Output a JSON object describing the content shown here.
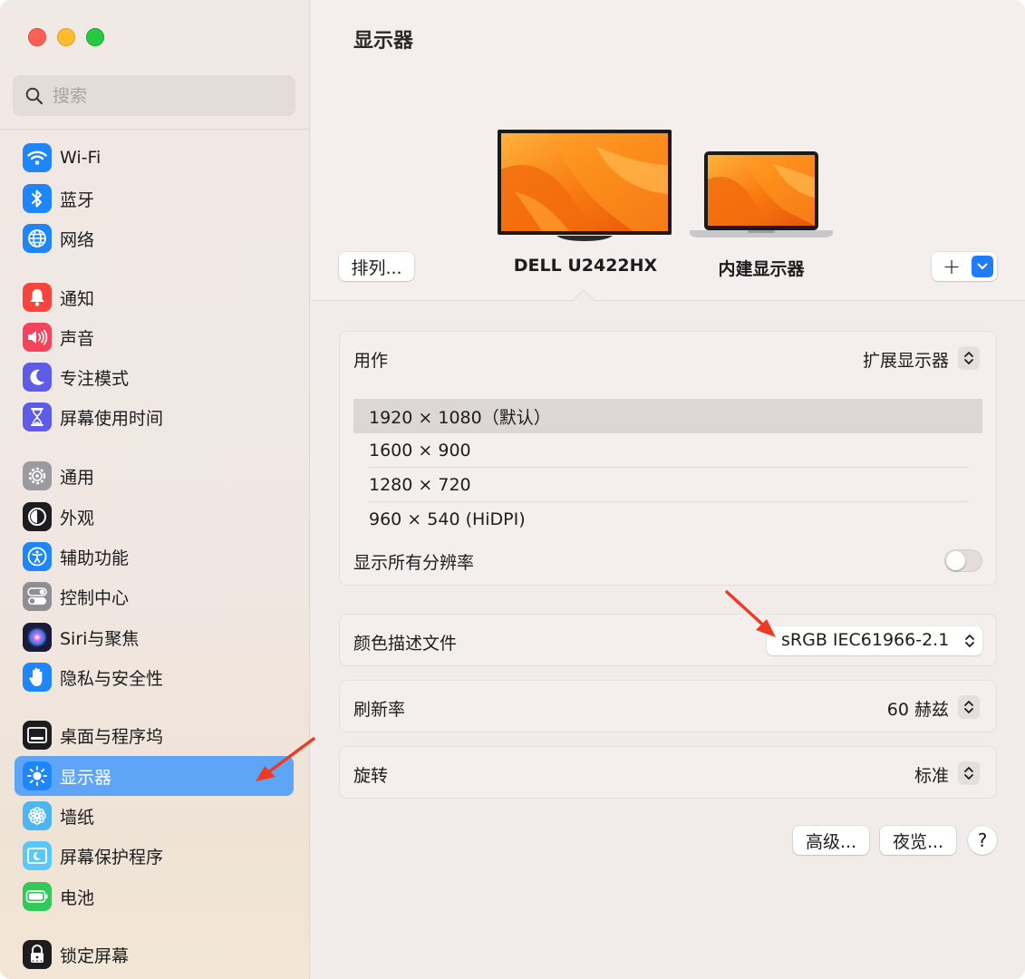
{
  "sidebar": {
    "search_placeholder": "搜索",
    "items": [
      {
        "label": "Wi-Fi",
        "icon": "wifi-icon",
        "color": "#1f86f8"
      },
      {
        "label": "蓝牙",
        "icon": "bluetooth-icon",
        "color": "#1f86f8"
      },
      {
        "label": "网络",
        "icon": "globe-icon",
        "color": "#1f86f8"
      },
      {
        "label": "通知",
        "icon": "bell-icon",
        "color": "#f7453b"
      },
      {
        "label": "声音",
        "icon": "speaker-icon",
        "color": "#f5435e"
      },
      {
        "label": "专注模式",
        "icon": "moon-icon",
        "color": "#5e5ce6"
      },
      {
        "label": "屏幕使用时间",
        "icon": "hourglass-icon",
        "color": "#5e5ce6"
      },
      {
        "label": "通用",
        "icon": "gear-icon",
        "color": "#8e8e93"
      },
      {
        "label": "外观",
        "icon": "appearance-icon",
        "color": "#1d1d1f"
      },
      {
        "label": "辅助功能",
        "icon": "accessibility-icon",
        "color": "#1f86f8"
      },
      {
        "label": "控制中心",
        "icon": "toggles-icon",
        "color": "#8e8e93"
      },
      {
        "label": "Siri与聚焦",
        "icon": "siri-icon",
        "color": "#2d2d6e"
      },
      {
        "label": "隐私与安全性",
        "icon": "hand-icon",
        "color": "#1f86f8"
      },
      {
        "label": "桌面与程序坞",
        "icon": "dock-icon",
        "color": "#1d1d1f"
      },
      {
        "label": "显示器",
        "icon": "sun-icon",
        "color": "#1f86f8"
      },
      {
        "label": "墙纸",
        "icon": "flower-icon",
        "color": "#36b2f0"
      },
      {
        "label": "屏幕保护程序",
        "icon": "screensaver-icon",
        "color": "#5ac8fa"
      },
      {
        "label": "电池",
        "icon": "battery-icon",
        "color": "#34c759"
      },
      {
        "label": "锁定屏幕",
        "icon": "lock-icon",
        "color": "#1d1d1f"
      }
    ],
    "active_index": 14
  },
  "main": {
    "title": "显示器",
    "arrange_button": "排列...",
    "displays": [
      {
        "label": "DELL U2422HX",
        "selected": true
      },
      {
        "label": "内建显示器",
        "selected": false
      }
    ],
    "add_button": "+",
    "use_as": {
      "label": "用作",
      "value": "扩展显示器"
    },
    "resolutions": [
      "1920 × 1080（默认）",
      "1600 × 900",
      "1280 × 720",
      "960 × 540 (HiDPI)"
    ],
    "selected_resolution": 0,
    "show_all": {
      "label": "显示所有分辨率",
      "on": false
    },
    "color_profile": {
      "label": "颜色描述文件",
      "value": "sRGB IEC61966-2.1"
    },
    "refresh_rate": {
      "label": "刷新率",
      "value": "60 赫兹"
    },
    "rotation": {
      "label": "旋转",
      "value": "标准"
    },
    "advanced_button": "高级...",
    "night_shift_button": "夜览...",
    "help_button": "?"
  },
  "colors": {
    "accent": "#5ea5f8",
    "annotation_arrow": "#ee3a24"
  }
}
